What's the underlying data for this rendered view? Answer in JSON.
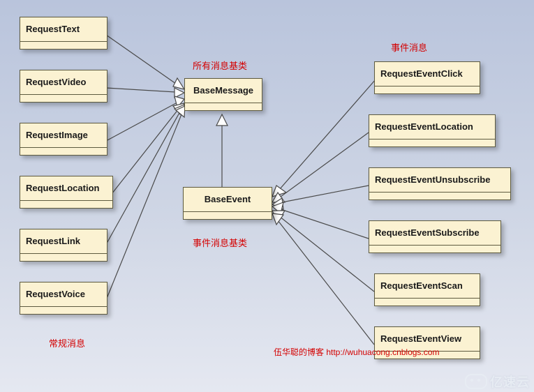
{
  "labels": {
    "all_msg_base": "所有消息基类",
    "event_msg": "事件消息",
    "event_msg_base": "事件消息基类",
    "regular_msg": "常规消息",
    "attribution": "伍华聪的博客 http://wuhuacong.cnblogs.com"
  },
  "watermark": "亿速云",
  "classes": {
    "BaseMessage": "BaseMessage",
    "BaseEvent": "BaseEvent",
    "RequestText": "RequestText",
    "RequestVideo": "RequestVideo",
    "RequestImage": "RequestImage",
    "RequestLocation": "RequestLocation",
    "RequestLink": "RequestLink",
    "RequestVoice": "RequestVoice",
    "RequestEventClick": "RequestEventClick",
    "RequestEventLocation": "RequestEventLocation",
    "RequestEventUnsubscribe": "RequestEventUnsubscribe",
    "RequestEventSubscribe": "RequestEventSubscribe",
    "RequestEventScan": "RequestEventScan",
    "RequestEventView": "RequestEventView"
  },
  "chart_data": {
    "type": "diagram",
    "kind": "uml-class-inheritance",
    "title": "",
    "nodes": [
      {
        "id": "BaseMessage",
        "stereotype": "class",
        "category": "all_msg_base"
      },
      {
        "id": "BaseEvent",
        "stereotype": "class",
        "category": "event_msg_base"
      },
      {
        "id": "RequestText",
        "stereotype": "class",
        "category": "regular_msg"
      },
      {
        "id": "RequestVideo",
        "stereotype": "class",
        "category": "regular_msg"
      },
      {
        "id": "RequestImage",
        "stereotype": "class",
        "category": "regular_msg"
      },
      {
        "id": "RequestLocation",
        "stereotype": "class",
        "category": "regular_msg"
      },
      {
        "id": "RequestLink",
        "stereotype": "class",
        "category": "regular_msg"
      },
      {
        "id": "RequestVoice",
        "stereotype": "class",
        "category": "regular_msg"
      },
      {
        "id": "RequestEventClick",
        "stereotype": "class",
        "category": "event_msg"
      },
      {
        "id": "RequestEventLocation",
        "stereotype": "class",
        "category": "event_msg"
      },
      {
        "id": "RequestEventUnsubscribe",
        "stereotype": "class",
        "category": "event_msg"
      },
      {
        "id": "RequestEventSubscribe",
        "stereotype": "class",
        "category": "event_msg"
      },
      {
        "id": "RequestEventScan",
        "stereotype": "class",
        "category": "event_msg"
      },
      {
        "id": "RequestEventView",
        "stereotype": "class",
        "category": "event_msg"
      }
    ],
    "edges": [
      {
        "from": "RequestText",
        "to": "BaseMessage",
        "relation": "inherits"
      },
      {
        "from": "RequestVideo",
        "to": "BaseMessage",
        "relation": "inherits"
      },
      {
        "from": "RequestImage",
        "to": "BaseMessage",
        "relation": "inherits"
      },
      {
        "from": "RequestLocation",
        "to": "BaseMessage",
        "relation": "inherits"
      },
      {
        "from": "RequestLink",
        "to": "BaseMessage",
        "relation": "inherits"
      },
      {
        "from": "RequestVoice",
        "to": "BaseMessage",
        "relation": "inherits"
      },
      {
        "from": "BaseEvent",
        "to": "BaseMessage",
        "relation": "inherits"
      },
      {
        "from": "RequestEventClick",
        "to": "BaseEvent",
        "relation": "inherits"
      },
      {
        "from": "RequestEventLocation",
        "to": "BaseEvent",
        "relation": "inherits"
      },
      {
        "from": "RequestEventUnsubscribe",
        "to": "BaseEvent",
        "relation": "inherits"
      },
      {
        "from": "RequestEventSubscribe",
        "to": "BaseEvent",
        "relation": "inherits"
      },
      {
        "from": "RequestEventScan",
        "to": "BaseEvent",
        "relation": "inherits"
      },
      {
        "from": "RequestEventView",
        "to": "BaseEvent",
        "relation": "inherits"
      }
    ]
  }
}
